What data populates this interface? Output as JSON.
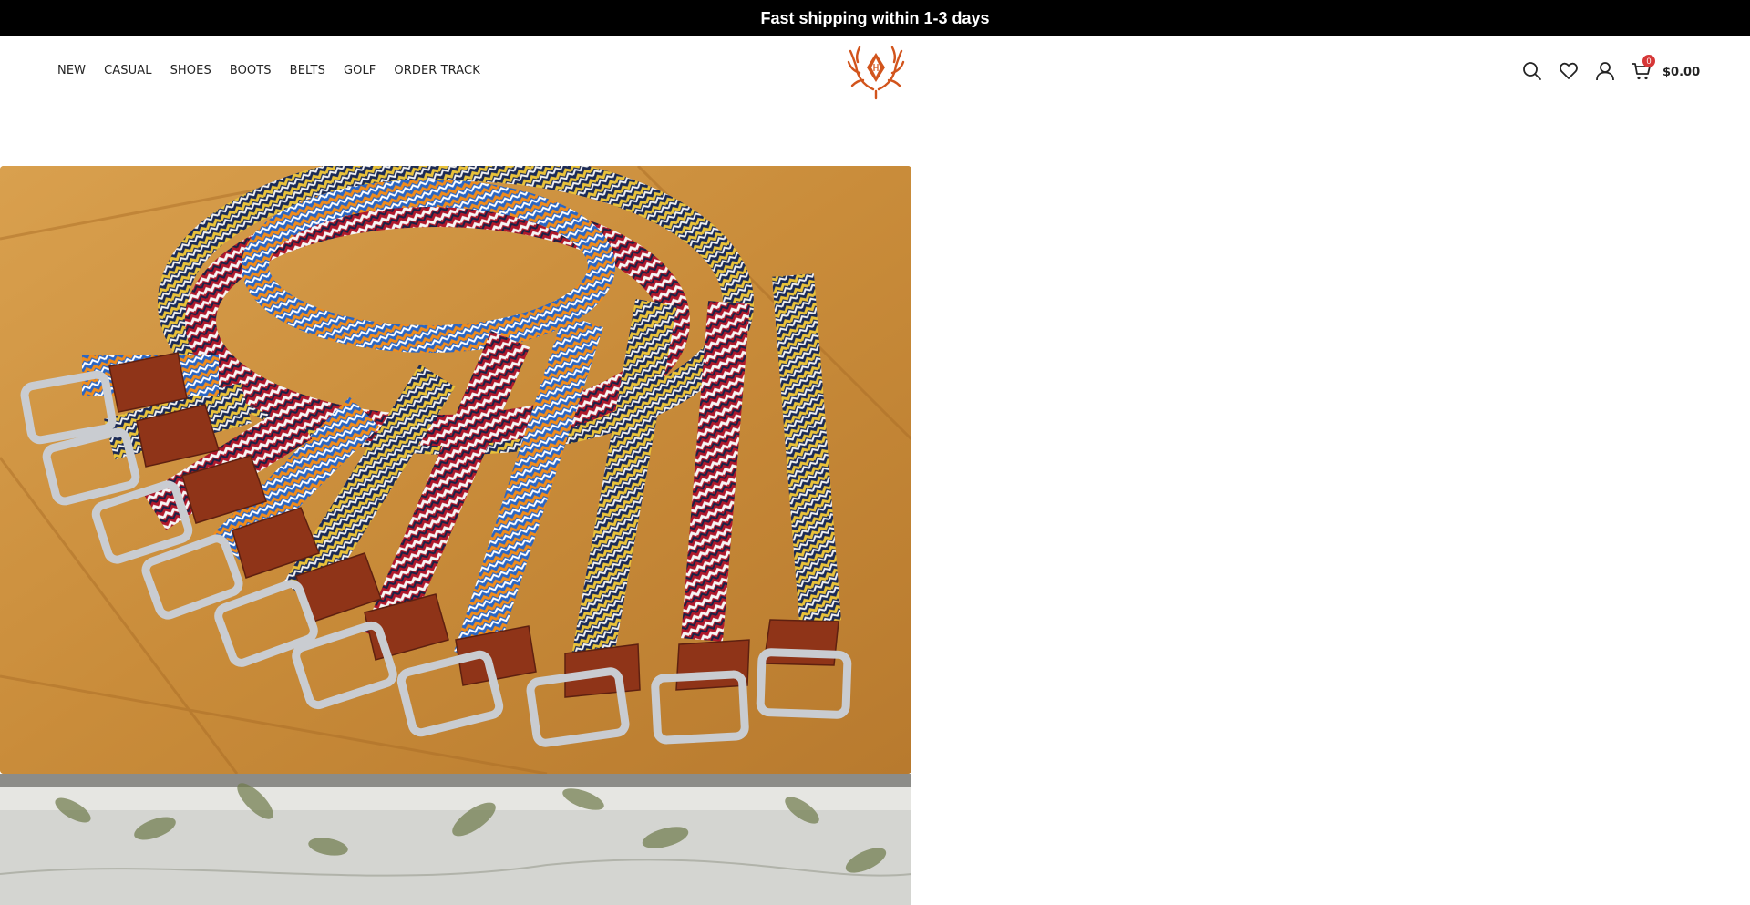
{
  "announcement": {
    "text": "Fast shipping within 1-3 days"
  },
  "nav": {
    "items": [
      {
        "label": "NEW"
      },
      {
        "label": "CASUAL"
      },
      {
        "label": "SHOES"
      },
      {
        "label": "BOOTS"
      },
      {
        "label": "BELTS"
      },
      {
        "label": "GOLF"
      },
      {
        "label": "ORDER TRACK"
      }
    ]
  },
  "header_icons": {
    "search": "search-icon",
    "wishlist": "heart-icon",
    "account": "user-icon",
    "cart": "cart-icon"
  },
  "cart": {
    "count": "0",
    "total": "$0.00"
  },
  "colors": {
    "topbar_bg": "#000000",
    "badge": "#d63737",
    "logo": "#d2541c"
  }
}
